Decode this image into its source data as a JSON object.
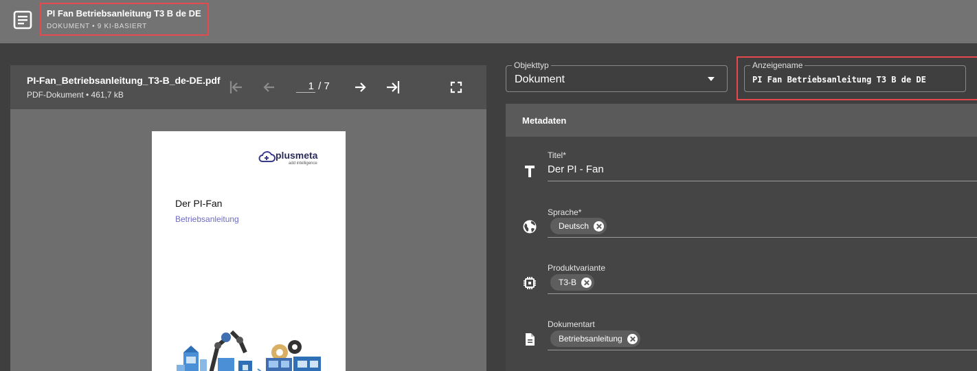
{
  "header": {
    "title": "PI Fan Betriebsanleitung T3 B de DE",
    "subtitle": "DOKUMENT • 9 KI-BASIERT"
  },
  "viewer": {
    "filename": "PI-Fan_Betriebsanleitung_T3-B_de-DE.pdf",
    "filemeta": "PDF-Dokument • 461,7 kB",
    "page_current": "1",
    "page_total": "/ 7",
    "preview": {
      "logo_word": "plusmeta",
      "logo_tag": "add intelligence",
      "title": "Der PI-Fan",
      "subtitle": "Betriebsanleitung"
    }
  },
  "form": {
    "objekttyp_label": "Objekttyp",
    "objekttyp_value": "Dokument",
    "anzeigename_label": "Anzeigename",
    "anzeigename_value": "PI Fan Betriebsanleitung T3 B de DE"
  },
  "metadata": {
    "heading": "Metadaten",
    "titel_label": "Titel*",
    "titel_value": "Der PI - Fan",
    "sprache_label": "Sprache*",
    "sprache_chip": "Deutsch",
    "produkt_label": "Produktvariante",
    "produkt_chip": "T3-B",
    "dokart_label": "Dokumentart",
    "dokart_chip": "Betriebsanleitung"
  },
  "colors": {
    "highlight": "#e5484d",
    "accent_purple": "#6f6cc4"
  }
}
